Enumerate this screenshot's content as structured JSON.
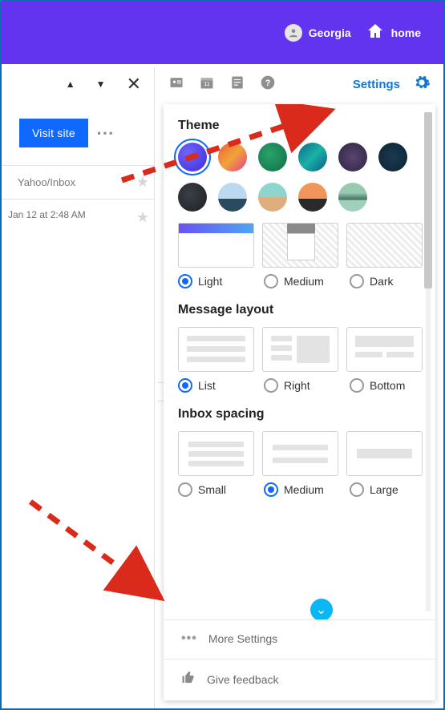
{
  "header": {
    "user_name": "Georgia",
    "home_label": "home"
  },
  "toolbar": {
    "settings_label": "Settings"
  },
  "left": {
    "visit_button": "Visit site",
    "folder_label": "Yahoo/Inbox",
    "timestamp": "Jan 12 at 2:48 AM"
  },
  "panel": {
    "theme_title": "Theme",
    "density_options": {
      "light": "Light",
      "medium": "Medium",
      "dark": "Dark"
    },
    "layout_title": "Message layout",
    "layout_options": {
      "list": "List",
      "right": "Right",
      "bottom": "Bottom"
    },
    "spacing_title": "Inbox spacing",
    "spacing_options": {
      "small": "Small",
      "medium": "Medium",
      "large": "Large"
    },
    "more_settings": "More Settings",
    "feedback": "Give feedback"
  }
}
